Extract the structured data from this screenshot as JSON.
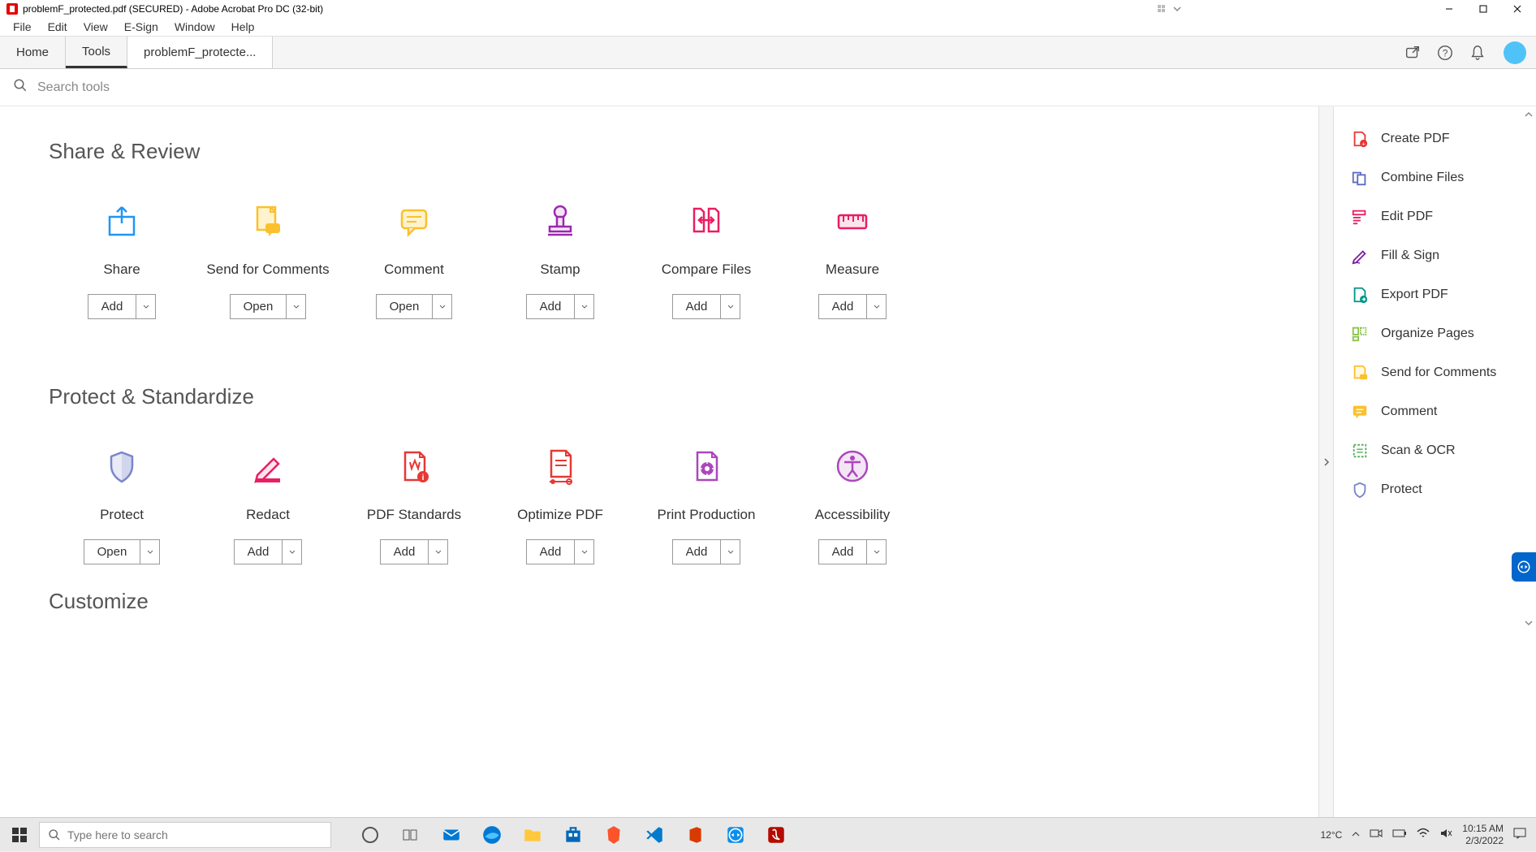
{
  "titlebar": {
    "title": "problemF_protected.pdf (SECURED) - Adobe Acrobat Pro DC (32-bit)"
  },
  "menubar": {
    "items": [
      "File",
      "Edit",
      "View",
      "E-Sign",
      "Window",
      "Help"
    ]
  },
  "tabs": {
    "home": "Home",
    "tools": "Tools",
    "doc": "problemF_protecte..."
  },
  "search": {
    "placeholder": "Search tools"
  },
  "sections": [
    {
      "title": "Share & Review",
      "tools": [
        {
          "name": "Share",
          "button": "Add",
          "icon": "share",
          "color": "#2196f3"
        },
        {
          "name": "Send for Comments",
          "button": "Open",
          "icon": "send-comments",
          "color": "#fbc02d"
        },
        {
          "name": "Comment",
          "button": "Open",
          "icon": "comment",
          "color": "#fbc02d"
        },
        {
          "name": "Stamp",
          "button": "Add",
          "icon": "stamp",
          "color": "#9c27b0"
        },
        {
          "name": "Compare Files",
          "button": "Add",
          "icon": "compare",
          "color": "#e91e63"
        },
        {
          "name": "Measure",
          "button": "Add",
          "icon": "measure",
          "color": "#e91e63"
        }
      ]
    },
    {
      "title": "Protect & Standardize",
      "tools": [
        {
          "name": "Protect",
          "button": "Open",
          "icon": "protect",
          "color": "#7986cb"
        },
        {
          "name": "Redact",
          "button": "Add",
          "icon": "redact",
          "color": "#e91e63"
        },
        {
          "name": "PDF Standards",
          "button": "Add",
          "icon": "pdf-standards",
          "color": "#e53935"
        },
        {
          "name": "Optimize PDF",
          "button": "Add",
          "icon": "optimize",
          "color": "#e53935"
        },
        {
          "name": "Print Production",
          "button": "Add",
          "icon": "print-production",
          "color": "#ab47bc"
        },
        {
          "name": "Accessibility",
          "button": "Add",
          "icon": "accessibility",
          "color": "#ab47bc"
        }
      ]
    },
    {
      "title": "Customize",
      "tools": []
    }
  ],
  "right_panel": {
    "items": [
      {
        "label": "Create PDF",
        "icon": "create-pdf",
        "color": "#e53935"
      },
      {
        "label": "Combine Files",
        "icon": "combine",
        "color": "#5c6bc0"
      },
      {
        "label": "Edit PDF",
        "icon": "edit-pdf",
        "color": "#e91e63"
      },
      {
        "label": "Fill & Sign",
        "icon": "fill-sign",
        "color": "#7b1fa2"
      },
      {
        "label": "Export PDF",
        "icon": "export-pdf",
        "color": "#009688"
      },
      {
        "label": "Organize Pages",
        "icon": "organize",
        "color": "#8bc34a"
      },
      {
        "label": "Send for Comments",
        "icon": "send-comments-sm",
        "color": "#fbc02d"
      },
      {
        "label": "Comment",
        "icon": "comment-sm",
        "color": "#fbc02d"
      },
      {
        "label": "Scan & OCR",
        "icon": "scan-ocr",
        "color": "#4caf50"
      },
      {
        "label": "Protect",
        "icon": "protect-sm",
        "color": "#7986cb"
      }
    ]
  },
  "taskbar": {
    "search_placeholder": "Type here to search",
    "temp": "12°C",
    "time": "10:15 AM",
    "date": "2/3/2022"
  }
}
